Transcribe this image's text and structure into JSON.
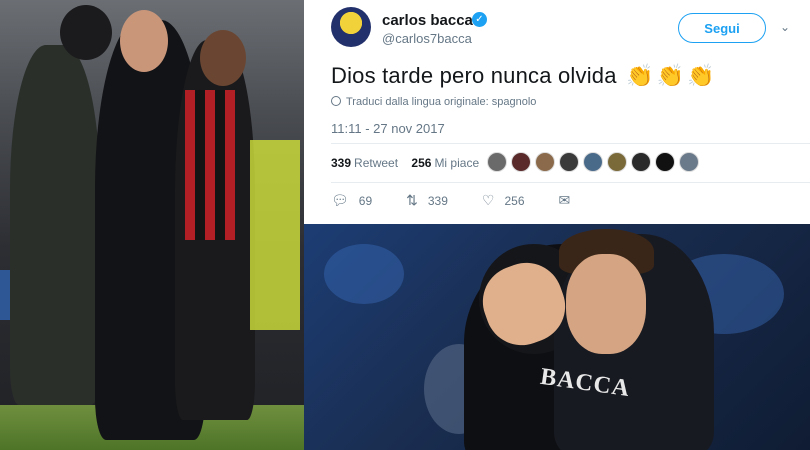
{
  "tweet": {
    "display_name": "carlos bacca",
    "handle": "@carlos7bacca",
    "follow_label": "Segui",
    "text": "Dios tarde pero nunca olvida",
    "emoji": [
      "👏",
      "👏",
      "👏"
    ],
    "translate_label": "Traduci dalla lingua originale: spagnolo",
    "timestamp": "11:11 - 27 nov 2017",
    "retweets_count": "339",
    "retweets_label": "Retweet",
    "likes_count": "256",
    "likes_label": "Mi piace",
    "liker_avatar_count": 9,
    "actions": {
      "reply_count": "69",
      "retweet_count": "339",
      "like_count": "256"
    }
  },
  "colors": {
    "accent": "#1da1f2",
    "text_primary": "#14171a",
    "text_secondary": "#657786"
  },
  "photos": {
    "bottom_right_jersey_text": "BACCA"
  }
}
